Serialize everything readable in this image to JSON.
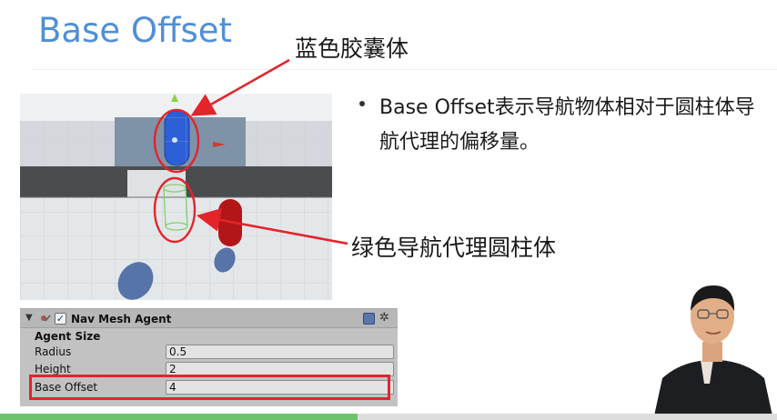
{
  "slide": {
    "title": "Base Offset",
    "callout_capsule": "蓝色胶囊体",
    "callout_cylinder": "绿色导航代理圆柱体",
    "bullet": "Base Offset表示导航物体相对于圆柱体导航代理的偏移量。"
  },
  "inspector": {
    "component_name": "Nav Mesh Agent",
    "section": "Agent Size",
    "fields": [
      {
        "label": "Radius",
        "value": "0.5"
      },
      {
        "label": "Height",
        "value": "2"
      },
      {
        "label": "Base Offset",
        "value": "4"
      }
    ],
    "enabled_checkmark": "✓",
    "foldout_glyph": "▼",
    "gear_glyph": "✲"
  },
  "icons": {
    "component": "nav-mesh-agent-icon",
    "help": "help-book-icon",
    "settings": "gear-icon"
  },
  "colors": {
    "title": "#4f8fd6",
    "annotation_red": "#e3242b",
    "capsule_blue": "#2d5fd6",
    "cylinder_green": "#7fd36a",
    "capsule_red": "#b31616",
    "progress_green": "#6cc36c"
  },
  "video_progress": 0.46
}
